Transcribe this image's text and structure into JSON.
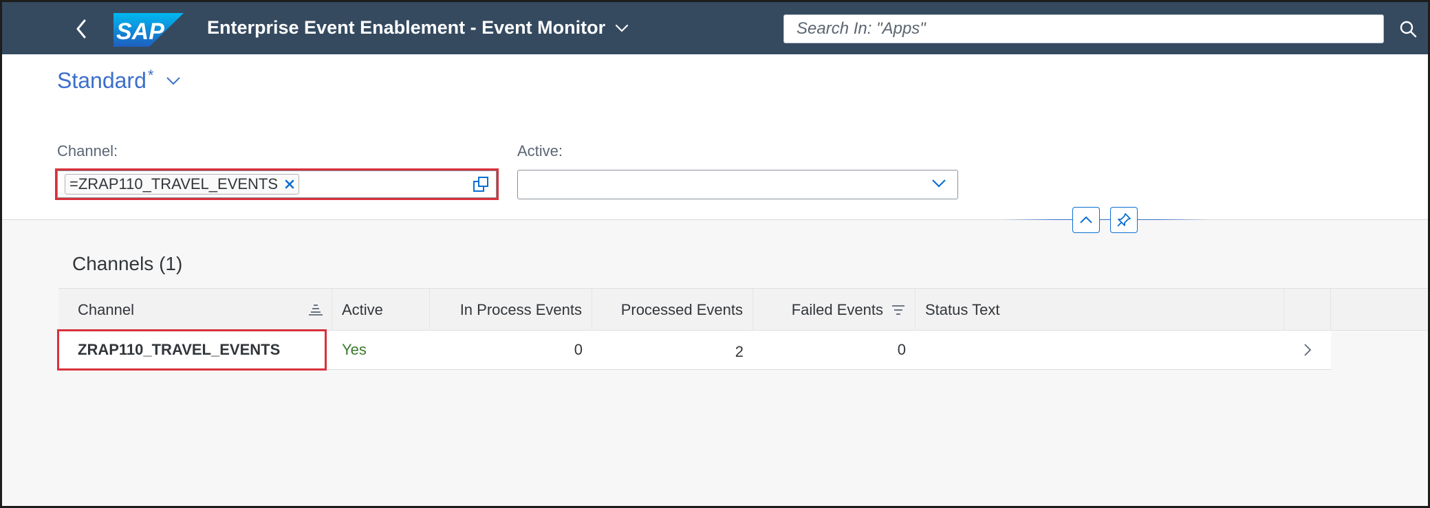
{
  "shell": {
    "logo_text": "SAP",
    "app_title": "Enterprise Event Enablement - Event Monitor",
    "search_placeholder": "Search In: \"Apps\""
  },
  "filterbar": {
    "variant_name": "Standard",
    "variant_modified": "*",
    "channel_label": "Channel:",
    "channel_token": "=ZRAP110_TRAVEL_EVENTS",
    "active_label": "Active:",
    "active_value": ""
  },
  "table": {
    "title": "Channels (1)",
    "columns": [
      "Channel",
      "Active",
      "In Process Events",
      "Processed Events",
      "Failed Events",
      "Status Text"
    ],
    "rows": [
      {
        "channel": "ZRAP110_TRAVEL_EVENTS",
        "active": "Yes",
        "in_process": "0",
        "processed": "2",
        "failed": "0",
        "status_text": ""
      }
    ]
  },
  "colors": {
    "shell": "#354a5f",
    "link": "#3b6fc9",
    "positive": "#3a7a2a",
    "highlight": "#d9303a"
  },
  "icons": [
    "back-arrow-icon",
    "chevron-down-icon",
    "search-icon",
    "decline-icon",
    "value-help-icon",
    "collapse-icon",
    "pin-icon",
    "sort-icon",
    "filter-icon",
    "navigation-arrow-icon"
  ]
}
